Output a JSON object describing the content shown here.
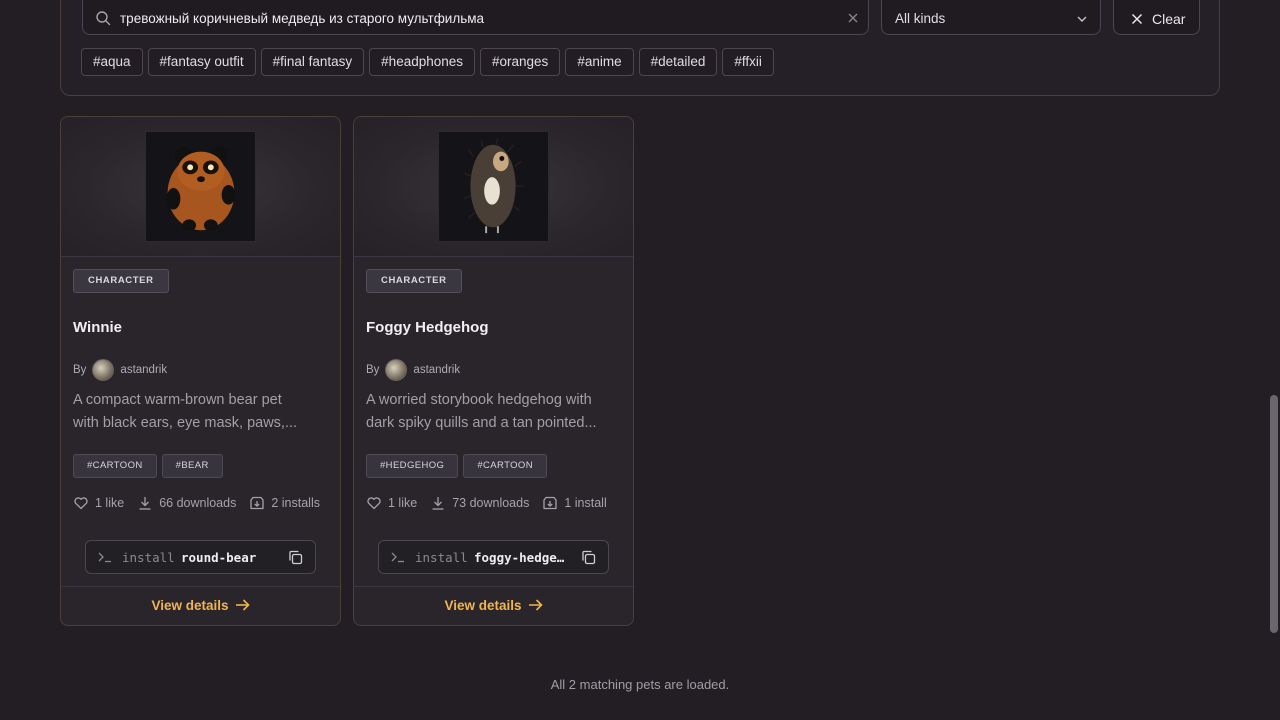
{
  "search": {
    "query": "тревожный коричневый медведь из старого мультфильма",
    "kind_selected": "All kinds",
    "clear_label": "Clear",
    "tags": [
      "#aqua",
      "#fantasy outfit",
      "#final fantasy",
      "#headphones",
      "#oranges",
      "#anime",
      "#detailed",
      "#ffxii"
    ]
  },
  "cards": [
    {
      "kind": "CHARACTER",
      "title": "Winnie",
      "by_label": "By",
      "author": "astandrik",
      "desc_line1": "A compact warm-brown bear pet",
      "desc_line2": "with black ears, eye mask, paws,...",
      "tags": [
        "#CARTOON",
        "#BEAR"
      ],
      "likes": "1 like",
      "downloads": "66 downloads",
      "installs": "2 installs",
      "install_cmd": "install",
      "install_slug": "round-bear",
      "view_label": "View details"
    },
    {
      "kind": "CHARACTER",
      "title": "Foggy Hedgehog",
      "by_label": "By",
      "author": "astandrik",
      "desc_line1": "A worried storybook hedgehog with",
      "desc_line2": "dark spiky quills and a tan pointed...",
      "tags": [
        "#HEDGEHOG",
        "#CARTOON"
      ],
      "likes": "1 like",
      "downloads": "73 downloads",
      "installs": "1 install",
      "install_cmd": "install",
      "install_slug": "foggy-hedgehog",
      "view_label": "View details"
    }
  ],
  "status": "All 2 matching pets are loaded.",
  "colors": {
    "accent": "#f0b450",
    "background": "#221e24",
    "card_border": "#4a4038"
  }
}
